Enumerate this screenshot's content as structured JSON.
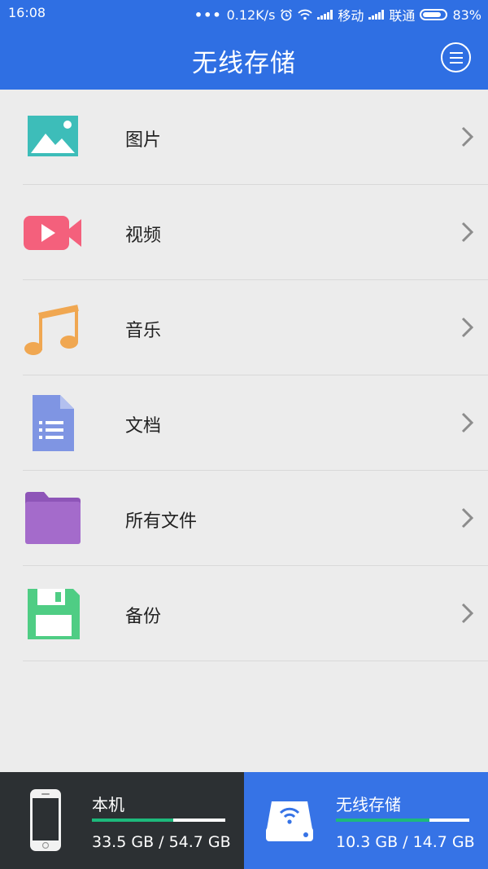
{
  "status_bar": {
    "time": "16:08",
    "net_speed": "0.12K/s",
    "carrier1": "移动",
    "carrier2": "联通",
    "battery": "83%",
    "icons": [
      "more-dots-icon",
      "alarm-icon",
      "wifi-icon",
      "signal-icon",
      "signal-icon",
      "battery-icon"
    ]
  },
  "app_bar": {
    "title": "无线存储",
    "menu_icon": "menu-icon"
  },
  "menu_items": [
    {
      "label": "图片",
      "icon": "image-icon",
      "color": "#3dbdb9"
    },
    {
      "label": "视频",
      "icon": "video-icon",
      "color": "#f4607c"
    },
    {
      "label": "音乐",
      "icon": "music-icon",
      "color": "#f0a751"
    },
    {
      "label": "文档",
      "icon": "document-icon",
      "color": "#7f95e3"
    },
    {
      "label": "所有文件",
      "icon": "folder-icon",
      "color": "#a46bcb"
    },
    {
      "label": "备份",
      "icon": "floppy-disk-icon",
      "color": "#4fcd84"
    }
  ],
  "storage": {
    "local": {
      "name": "本机",
      "size": "33.5 GB / 54.7 GB",
      "used_fraction": 0.61,
      "icon": "phone-icon"
    },
    "wireless": {
      "name": "无线存储",
      "size": "10.3 GB / 14.7 GB",
      "used_fraction": 0.7,
      "icon": "wireless-drive-icon"
    }
  },
  "colors": {
    "primary": "#2f6fe3",
    "footer_local": "#2c3033",
    "footer_wireless": "#3673e6",
    "progress": "#1db97c"
  }
}
